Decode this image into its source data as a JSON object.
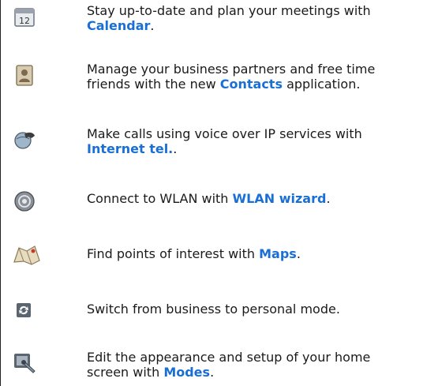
{
  "items": [
    {
      "icon": "calendar-icon",
      "text_before": "Stay up-to-date and plan your meetings with ",
      "link": "Calendar",
      "text_after": "."
    },
    {
      "icon": "contacts-icon",
      "text_before": "Manage your business partners and free time friends with the new ",
      "link": "Contacts",
      "text_after": " application."
    },
    {
      "icon": "internet-tel-icon",
      "text_before": "Make calls using voice over IP services with ",
      "link": "Internet tel.",
      "text_after": "."
    },
    {
      "icon": "wlan-wizard-icon",
      "text_before": "Connect to WLAN with ",
      "link": "WLAN wizard",
      "text_after": "."
    },
    {
      "icon": "maps-icon",
      "text_before": "Find points of interest with ",
      "link": "Maps",
      "text_after": "."
    },
    {
      "icon": "mode-switch-icon",
      "text_before": "Switch from business to personal mode.",
      "link": "",
      "text_after": ""
    },
    {
      "icon": "modes-icon",
      "text_before": "Edit the appearance and setup of your home screen with ",
      "link": "Modes",
      "text_after": "."
    }
  ],
  "colors": {
    "link": "#1a6fd6",
    "text": "#1a1a1a"
  }
}
